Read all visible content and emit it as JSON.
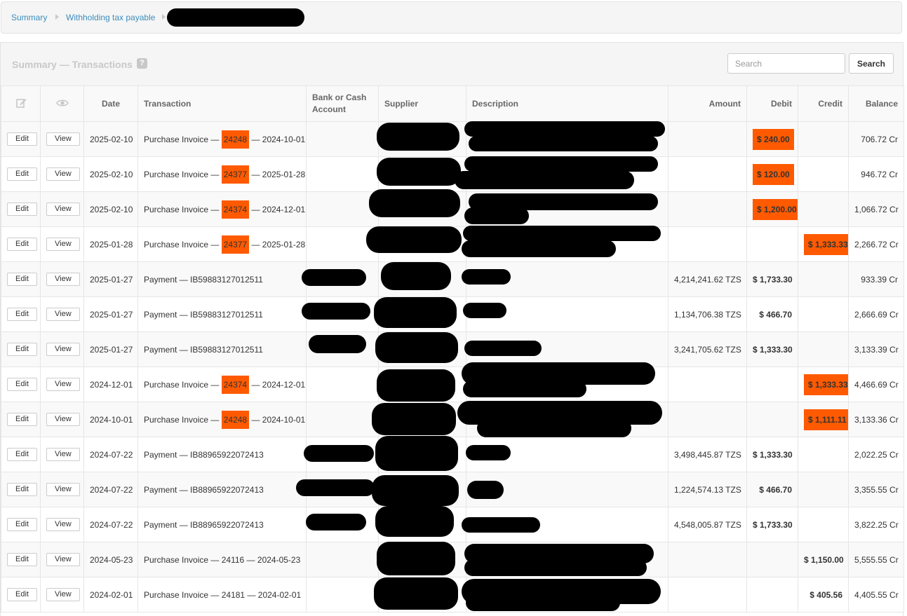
{
  "breadcrumb": {
    "items": [
      "Summary",
      "Withholding tax payable"
    ]
  },
  "panel": {
    "title": "Summary — Transactions",
    "help_glyph": "?"
  },
  "search": {
    "placeholder": "Search",
    "button_label": "Search"
  },
  "table": {
    "columns": {
      "edit_icon": "edit-icon",
      "view_icon": "eye-icon",
      "date": "Date",
      "transaction": "Transaction",
      "account": "Bank or Cash Account",
      "supplier": "Supplier",
      "description": "Description",
      "amount": "Amount",
      "debit": "Debit",
      "credit": "Credit",
      "balance": "Balance"
    },
    "edit_label": "Edit",
    "view_label": "View",
    "highlight_color": "#ff5a00",
    "rows": [
      {
        "date": "2025-02-10",
        "type": "Purchase Invoice",
        "ref": "24248",
        "ref_date": "2024-10-01",
        "ref_hl": true,
        "amount": "",
        "debit": "$ 240.00",
        "debit_hl": true,
        "credit": "",
        "credit_hl": false,
        "balance": "706.72 Cr"
      },
      {
        "date": "2025-02-10",
        "type": "Purchase Invoice",
        "ref": "24377",
        "ref_date": "2025-01-28",
        "ref_hl": true,
        "amount": "",
        "debit": "$ 120.00",
        "debit_hl": true,
        "credit": "",
        "credit_hl": false,
        "balance": "946.72 Cr"
      },
      {
        "date": "2025-02-10",
        "type": "Purchase Invoice",
        "ref": "24374",
        "ref_date": "2024-12-01",
        "ref_hl": true,
        "amount": "",
        "debit": "$ 1,200.00",
        "debit_hl": true,
        "credit": "",
        "credit_hl": false,
        "balance": "1,066.72 Cr"
      },
      {
        "date": "2025-01-28",
        "type": "Purchase Invoice",
        "ref": "24377",
        "ref_date": "2025-01-28",
        "ref_hl": true,
        "amount": "",
        "debit": "",
        "debit_hl": false,
        "credit": "$ 1,333.33",
        "credit_hl": true,
        "balance": "2,266.72 Cr"
      },
      {
        "date": "2025-01-27",
        "type": "Payment",
        "ref": "IB59883127012511",
        "ref_date": "",
        "ref_hl": false,
        "amount": "4,214,241.62 TZS",
        "debit": "$ 1,733.30",
        "debit_hl": false,
        "credit": "",
        "credit_hl": false,
        "balance": "933.39 Cr"
      },
      {
        "date": "2025-01-27",
        "type": "Payment",
        "ref": "IB59883127012511",
        "ref_date": "",
        "ref_hl": false,
        "amount": "1,134,706.38 TZS",
        "debit": "$ 466.70",
        "debit_hl": false,
        "credit": "",
        "credit_hl": false,
        "balance": "2,666.69 Cr"
      },
      {
        "date": "2025-01-27",
        "type": "Payment",
        "ref": "IB59883127012511",
        "ref_date": "",
        "ref_hl": false,
        "amount": "3,241,705.62 TZS",
        "debit": "$ 1,333.30",
        "debit_hl": false,
        "credit": "",
        "credit_hl": false,
        "balance": "3,133.39 Cr"
      },
      {
        "date": "2024-12-01",
        "type": "Purchase Invoice",
        "ref": "24374",
        "ref_date": "2024-12-01",
        "ref_hl": true,
        "amount": "",
        "debit": "",
        "debit_hl": false,
        "credit": "$ 1,333.33",
        "credit_hl": true,
        "balance": "4,466.69 Cr"
      },
      {
        "date": "2024-10-01",
        "type": "Purchase Invoice",
        "ref": "24248",
        "ref_date": "2024-10-01",
        "ref_hl": true,
        "amount": "",
        "debit": "",
        "debit_hl": false,
        "credit": "$ 1,111.11",
        "credit_hl": true,
        "balance": "3,133.36 Cr"
      },
      {
        "date": "2024-07-22",
        "type": "Payment",
        "ref": "IB88965922072413",
        "ref_date": "",
        "ref_hl": false,
        "amount": "3,498,445.87 TZS",
        "debit": "$ 1,333.30",
        "debit_hl": false,
        "credit": "",
        "credit_hl": false,
        "balance": "2,022.25 Cr"
      },
      {
        "date": "2024-07-22",
        "type": "Payment",
        "ref": "IB88965922072413",
        "ref_date": "",
        "ref_hl": false,
        "amount": "1,224,574.13 TZS",
        "debit": "$ 466.70",
        "debit_hl": false,
        "credit": "",
        "credit_hl": false,
        "balance": "3,355.55 Cr"
      },
      {
        "date": "2024-07-22",
        "type": "Payment",
        "ref": "IB88965922072413",
        "ref_date": "",
        "ref_hl": false,
        "amount": "4,548,005.87 TZS",
        "debit": "$ 1,733.30",
        "debit_hl": false,
        "credit": "",
        "credit_hl": false,
        "balance": "3,822.25 Cr"
      },
      {
        "date": "2024-05-23",
        "type": "Purchase Invoice",
        "ref": "24116",
        "ref_date": "2024-05-23",
        "ref_hl": false,
        "amount": "",
        "debit": "",
        "debit_hl": false,
        "credit": "$ 1,150.00",
        "credit_hl": false,
        "balance": "5,555.55 Cr"
      },
      {
        "date": "2024-02-01",
        "type": "Purchase Invoice",
        "ref": "24181",
        "ref_date": "2024-02-01",
        "ref_hl": false,
        "amount": "",
        "debit": "",
        "debit_hl": false,
        "credit": "$ 405.56",
        "credit_hl": false,
        "balance": "4,405.55 Cr"
      }
    ]
  }
}
